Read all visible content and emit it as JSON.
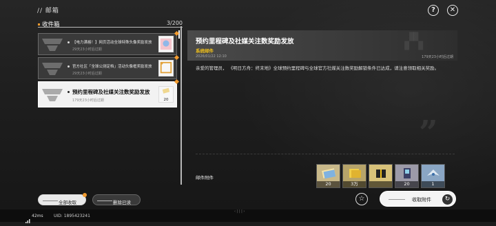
{
  "header": {
    "breadcrumb": "// 邮箱"
  },
  "inbox": {
    "label": "收件箱",
    "count": "3/200",
    "mails": [
      {
        "title": "【电力满格！】网页活动全球特殊头像奖励发放",
        "expire": "29天23小时后过期"
      },
      {
        "title": "官方社区「全球公测定档」活动头像框奖励发放",
        "expire": "29天23小时后过期"
      },
      {
        "title": "预约里程碑及社媒关注数奖励发放",
        "expire": "179天23小时后过期",
        "thumb_count": "20"
      }
    ]
  },
  "detail": {
    "title": "预约里程碑及社媒关注数奖励发放",
    "sender": "系统邮件",
    "date": "2026/01/22 12:10",
    "remain": "179天23小时后过期",
    "body": "亲爱的管理员， 《明日方舟：终末地》全球预约里程碑与全球官方社媒关注数奖励解锁条件已达成，请注意领取相关奖励。",
    "attachments_label": "邮件附件",
    "attachments": [
      {
        "count": "20",
        "color": "#e8c46a"
      },
      {
        "count": "3万",
        "color": "#d6b25a"
      },
      {
        "count": "",
        "color": "#c9a24e"
      },
      {
        "count": "20",
        "color": "#e0d8b8"
      },
      {
        "count": "1",
        "color": "#6fa8d8"
      }
    ]
  },
  "buttons": {
    "collect_all": "全部收取",
    "delete_read": "删除已读",
    "collect_attachment": "收取附件"
  },
  "footer": {
    "ping": "42ms",
    "uid": "UID: 1895423241"
  },
  "colors": {
    "accent": "#f29b2e",
    "sender": "#f2c21b"
  }
}
